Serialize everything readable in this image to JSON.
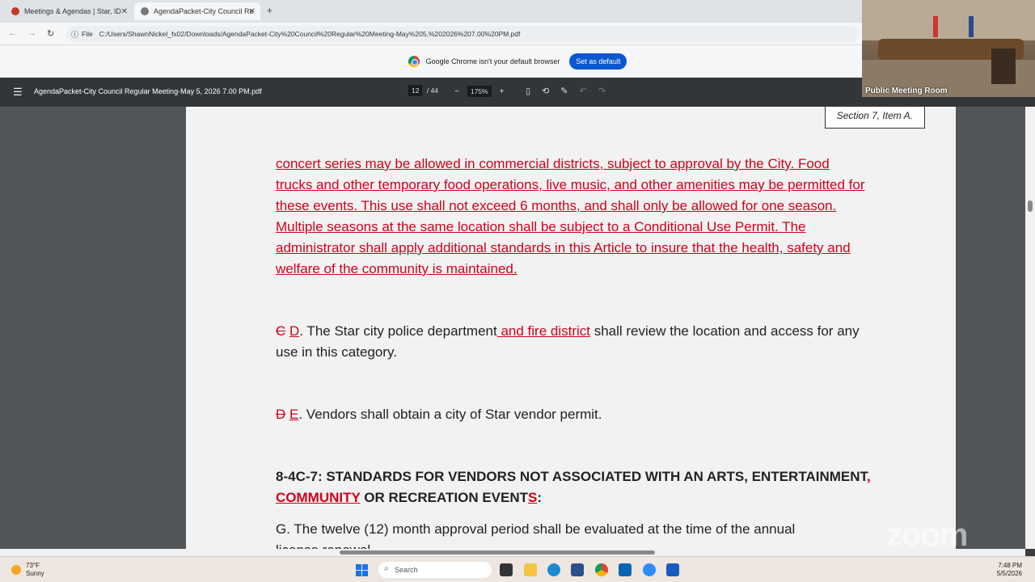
{
  "browser": {
    "tabs": [
      {
        "label": "Meetings & Agendas | Star, ID",
        "active": false
      },
      {
        "label": "AgendaPacket-City Council Re",
        "active": true
      }
    ],
    "new_tab": "+",
    "url_label": "File",
    "url": "C:/Users/ShawnNickel_fx02/Downloads/AgendaPacket-City%20Council%20Regular%20Meeting-May%205,%202026%207.00%20PM.pdf"
  },
  "infobar": {
    "message": "Google Chrome isn't your default browser",
    "button": "Set as default"
  },
  "pdf_toolbar": {
    "title": "AgendaPacket-City Council Regular Meeting-May 5, 2026 7.00 PM.pdf",
    "page_current": "12",
    "page_total": "/ 44",
    "zoom": "175%",
    "zoom_out": "−",
    "zoom_in": "+"
  },
  "document": {
    "section_label": "Section 7, Item A.",
    "red_paragraph": "concert series may be allowed in commercial districts, subject to approval by the City. Food trucks and other temporary food operations, live music, and other amenities may be permitted for these events. This use shall not exceed 6 months, and shall only be allowed for one season. Multiple seasons at the same location shall be subject to a Conditional Use Permit. The administrator shall apply additional standards in this Article to insure that the health, safety and welfare of the community is maintained.",
    "item_d": {
      "old_letter": "C",
      "new_letter": "D",
      "text_before": ". The Star city police department",
      "inserted": " and fire district",
      "text_after": " shall review the location and access for any use in this category."
    },
    "item_e": {
      "old_letter": "D",
      "new_letter": "E",
      "text": ". Vendors shall obtain a city of Star vendor permit."
    },
    "heading": {
      "part1": "8-4C-7: STANDARDS FOR VENDORS NOT ASSOCIATED WITH AN ARTS, ENTERTAINMENT",
      "inserted": ", COMMUNITY",
      "part2": " OR RECREATION EVENT",
      "inserted_s": "S",
      "colon": ":"
    },
    "item_g": "G. The twelve (12) month approval period shall be evaluated at the time of the annual",
    "item_g_cut": "license renewal."
  },
  "video": {
    "caption": "Public Meeting Room"
  },
  "watermark": "zoom",
  "taskbar": {
    "temp": "73°F",
    "condition": "Sunny",
    "search_placeholder": "Search",
    "time": "7:48 PM",
    "date": "5/5/2026"
  },
  "colors": {
    "redline": "#d0021b",
    "chrome_blue": "#0b57d0",
    "pdf_toolbar": "#323639"
  }
}
